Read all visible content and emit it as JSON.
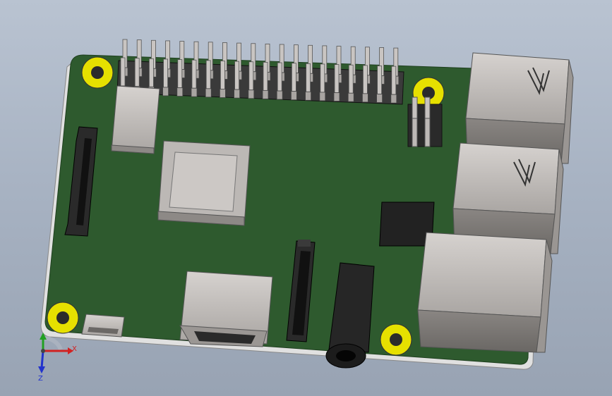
{
  "viewport": {
    "background_top": "#b9c3d1",
    "background_bottom": "#98a3b3"
  },
  "model": {
    "board_color": "#2e5a2e",
    "board_edge_color": "#dcdcdc",
    "mounting_hole_color": "#e6e000",
    "component_metal": "#b8b4b0",
    "chip_black": "#222222",
    "gpio_pin_count": 40
  },
  "triad": {
    "x_label": "X",
    "z_label": "Z",
    "x_color": "#d22222",
    "y_color": "#22a022",
    "z_color": "#2233cc"
  }
}
